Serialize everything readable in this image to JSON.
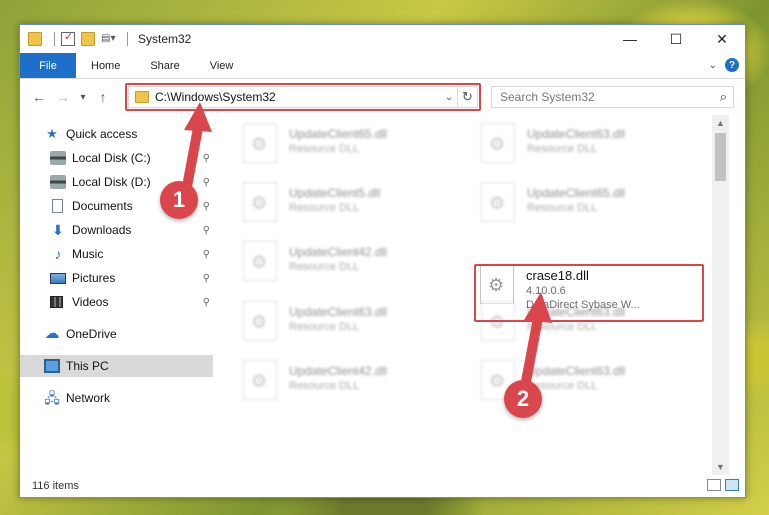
{
  "window": {
    "title": "System32",
    "controls": {
      "minimize": "—",
      "maximize": "☐",
      "close": "✕"
    }
  },
  "ribbon": {
    "tabs": [
      {
        "label": "File"
      },
      {
        "label": "Home"
      },
      {
        "label": "Share"
      },
      {
        "label": "View"
      }
    ],
    "help_label": "?"
  },
  "navigation": {
    "back": "←",
    "forward": "→",
    "recent": "▾",
    "up": "↑"
  },
  "address_bar": {
    "path": "C:\\Windows\\System32",
    "dropdown": "⌄",
    "refresh": "↻"
  },
  "search": {
    "placeholder": "Search System32",
    "icon": "⌕"
  },
  "sidebar": {
    "items": [
      {
        "label": "Quick access",
        "icon": "star-icon",
        "pinned": false
      },
      {
        "label": "Local Disk (C:)",
        "icon": "drive-icon",
        "pinned": true
      },
      {
        "label": "Local Disk (D:)",
        "icon": "drive-icon",
        "pinned": true
      },
      {
        "label": "Documents",
        "icon": "documents-icon",
        "pinned": true
      },
      {
        "label": "Downloads",
        "icon": "download-icon",
        "pinned": true
      },
      {
        "label": "Music",
        "icon": "music-icon",
        "pinned": true
      },
      {
        "label": "Pictures",
        "icon": "pictures-icon",
        "pinned": true
      },
      {
        "label": "Videos",
        "icon": "videos-icon",
        "pinned": true
      },
      {
        "label": "OneDrive",
        "icon": "cloud-icon",
        "pinned": false
      },
      {
        "label": "This PC",
        "icon": "computer-icon",
        "pinned": false,
        "selected": true
      },
      {
        "label": "Network",
        "icon": "network-icon",
        "pinned": false
      }
    ],
    "pin_glyph": "📌"
  },
  "files": {
    "items": [
      {
        "name": "UpdateClient65.dll",
        "desc": "Resource DLL"
      },
      {
        "name": "UpdateClient63.dll",
        "desc": "Resource DLL"
      },
      {
        "name": "UpdateClient5.dll",
        "desc": "Resource DLL"
      },
      {
        "name": "UpdateClient65.dll",
        "desc": "Resource DLL"
      },
      {
        "name": "UpdateClient42.dll",
        "desc": "Resource DLL"
      },
      {
        "name": "UpdateClient63.dll",
        "desc": "Resource DLL"
      },
      {
        "name": "UpdateClient63.dll",
        "desc": "Resource DLL"
      },
      {
        "name": "UpdateClient42.dll",
        "desc": "Resource DLL"
      },
      {
        "name": "UpdateClient63.dll",
        "desc": "Resource DLL"
      }
    ],
    "target": {
      "name": "crase18.dll",
      "version": "4.10.0.6",
      "desc": "DataDirect Sybase W..."
    }
  },
  "status": {
    "item_count": "116 items"
  },
  "annotations": {
    "marker_1": "1",
    "marker_2": "2",
    "color": "#d9464b"
  }
}
